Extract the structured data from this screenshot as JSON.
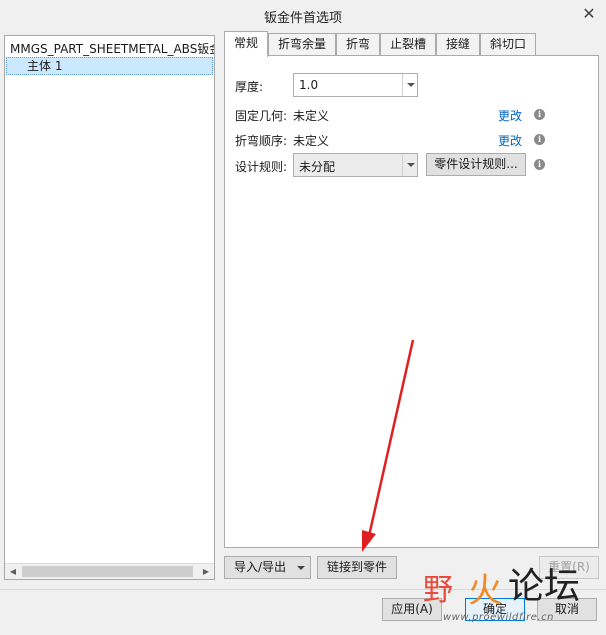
{
  "window": {
    "title": "钣金件首选项",
    "close_glyph": "✕"
  },
  "tree": {
    "root_label": "MMGS_PART_SHEETMETAL_ABS钣金",
    "child_label": "主体 1"
  },
  "tabs": [
    {
      "label": "常规",
      "active": true
    },
    {
      "label": "折弯余量",
      "active": false
    },
    {
      "label": "折弯",
      "active": false
    },
    {
      "label": "止裂槽",
      "active": false
    },
    {
      "label": "接缝",
      "active": false
    },
    {
      "label": "斜切口",
      "active": false
    }
  ],
  "general": {
    "thickness_label": "厚度:",
    "thickness_value": "1.0",
    "fixed_geometry_label": "固定几何:",
    "fixed_geometry_value": "未定义",
    "fixed_geometry_change": "更改",
    "bend_order_label": "折弯顺序:",
    "bend_order_value": "未定义",
    "bend_order_change": "更改",
    "design_rules_label": "设计规则:",
    "design_rules_value": "未分配",
    "design_rules_button": "零件设计规则..."
  },
  "footer": {
    "import_export": "导入/导出",
    "link_to_part": "链接到零件",
    "reset": "重置(R)",
    "apply": "应用(A)",
    "ok": "确定",
    "cancel": "取消"
  },
  "watermark": {
    "ye": "野",
    "huo": "火",
    "luntan": "论坛",
    "url": "www.proewildfire.cn"
  },
  "colors": {
    "link": "#0064c8",
    "selection": "#cce8ff",
    "arrow": "#e02020",
    "primary_border": "#0078d7"
  }
}
